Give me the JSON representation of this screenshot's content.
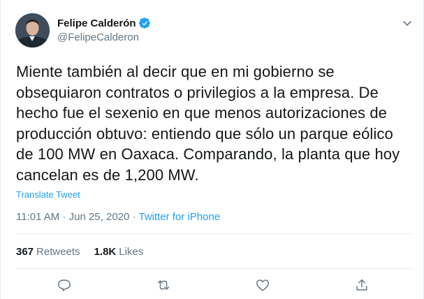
{
  "author": {
    "display_name": "Felipe Calderón",
    "handle": "@FelipeCalderon",
    "verified": true
  },
  "tweet": {
    "text": "Miente también al decir que en mi gobierno se\nobsequiaron contratos o privilegios a la empresa. De\nhecho fue el sexenio en que menos autorizaciones de\nproducción obtuvo: entiendo que sólo un parque eólico\nde 100 MW en Oaxaca. Comparando, la planta que hoy\ncancelan es de 1,200 MW.",
    "translate_label": "Translate Tweet",
    "time": "11:01 AM",
    "date": "Jun 25, 2020",
    "separator": "·",
    "source": "Twitter for iPhone"
  },
  "stats": {
    "retweets_count": "367",
    "retweets_label": "Retweets",
    "likes_count": "1.8K",
    "likes_label": "Likes"
  },
  "icons": {
    "reply": "reply-icon",
    "retweet": "retweet-icon",
    "like": "heart-icon",
    "share": "share-icon",
    "menu": "chevron-down-icon",
    "verified": "verified-badge-icon"
  },
  "colors": {
    "accent": "#1da1f2",
    "text": "#14171a",
    "muted": "#657786",
    "divider": "#e6ecf0"
  }
}
